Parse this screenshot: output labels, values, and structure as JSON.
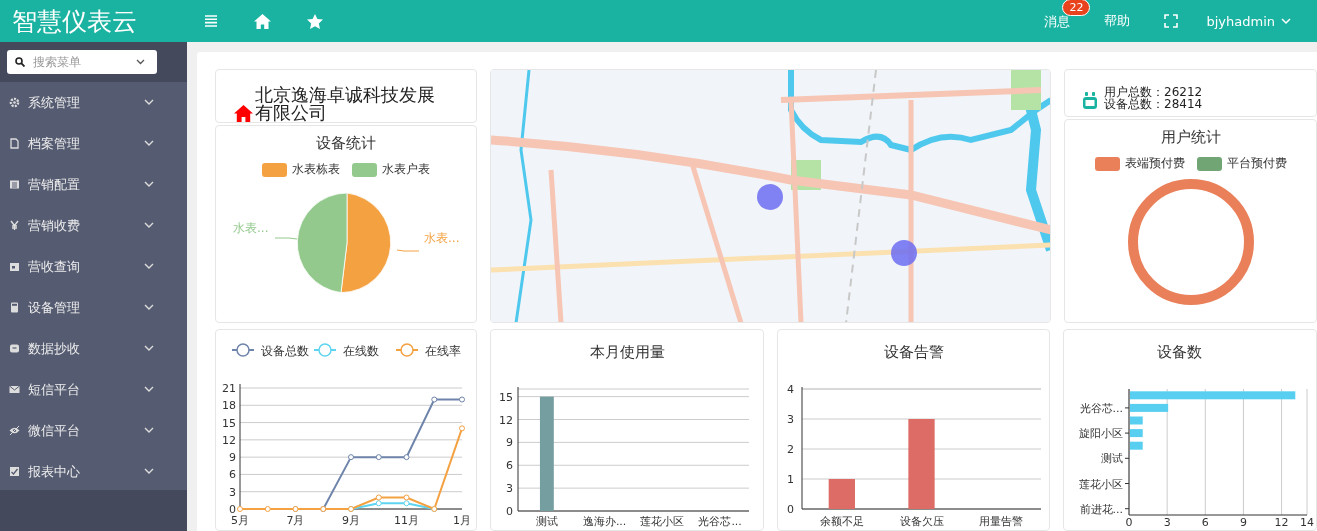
{
  "header": {
    "title": "智慧仪表云",
    "messages": {
      "label": "消息",
      "count": "22"
    },
    "help": "帮助",
    "user": "bjyhadmin"
  },
  "sidebar": {
    "search": {
      "placeholder": "搜索菜单"
    },
    "items": [
      {
        "label": "系统管理",
        "expanded": false
      },
      {
        "label": "档案管理",
        "expanded": false
      },
      {
        "label": "营销配置",
        "expanded": false
      },
      {
        "label": "营销收费",
        "expanded": false
      },
      {
        "label": "营收查询",
        "expanded": false
      },
      {
        "label": "设备管理",
        "expanded": false
      },
      {
        "label": "数据抄收",
        "expanded": false
      },
      {
        "label": "短信平台",
        "expanded": false
      },
      {
        "label": "微信平台",
        "expanded": false
      },
      {
        "label": "报表中心",
        "expanded": false
      }
    ]
  },
  "company": {
    "name": "北京逸海卓诚科技发展有限公司"
  },
  "device_stats": {
    "title": "设备统计",
    "legend": [
      {
        "label": "水表栋表",
        "color": "#f4a142",
        "slice_label": "水表..."
      },
      {
        "label": "水表户表",
        "color": "#93c98c",
        "slice_label": "水表..."
      }
    ]
  },
  "totals": [
    "用户总数：26212",
    "设备总数：28414"
  ],
  "user_stats": {
    "title": "用户统计",
    "legend": [
      {
        "label": "表端预付费",
        "color": "#e9805a"
      },
      {
        "label": "平台预付费",
        "color": "#72a574"
      }
    ]
  },
  "device_trend": {
    "chart_data": {
      "type": "line",
      "x": [
        "5月",
        null,
        "7月",
        null,
        "9月",
        null,
        "11月",
        null,
        "1月"
      ],
      "legend": "top",
      "grid": true,
      "ylim": [
        0,
        21
      ],
      "yticks": [
        0,
        3,
        6,
        9,
        12,
        15,
        18,
        21
      ],
      "series": [
        {
          "name": "设备总数",
          "color": "#6f84ab",
          "marker": "circle",
          "values": [
            null,
            null,
            0,
            0,
            9,
            9,
            9,
            19,
            19
          ]
        },
        {
          "name": "在线数",
          "color": "#5dd4f0",
          "marker": "circle",
          "values": [
            null,
            null,
            null,
            null,
            0,
            1,
            1,
            0,
            null
          ]
        },
        {
          "name": "在线率",
          "color": "#f4a142",
          "marker": "circle",
          "values": [
            0,
            0,
            0,
            0,
            0,
            2,
            2,
            0,
            14
          ]
        }
      ]
    }
  },
  "monthly_usage": {
    "chart_data": {
      "type": "bar",
      "title": "本月使用量",
      "grid": true,
      "categories": [
        "测试",
        "逸海办...",
        "莲花小区",
        "光谷芯..."
      ],
      "ylim": [
        0,
        16
      ],
      "yticks": [
        0,
        3,
        6,
        9,
        12,
        15
      ],
      "series": [
        {
          "color": "#749e9f",
          "values": [
            15,
            0,
            0,
            0
          ]
        }
      ]
    }
  },
  "device_alarms": {
    "chart_data": {
      "type": "bar",
      "title": "设备告警",
      "grid": true,
      "categories": [
        "余额不足",
        "设备欠压",
        "用量告警"
      ],
      "ylim": [
        0,
        4
      ],
      "yticks": [
        0,
        1,
        2,
        3,
        4
      ],
      "series": [
        {
          "color": "#dd6b66",
          "values": [
            1,
            3,
            0
          ]
        }
      ]
    }
  },
  "device_count": {
    "chart_data": {
      "type": "bar",
      "orientation": "horizontal",
      "title": "设备数",
      "grid": true,
      "categories": [
        null,
        "光谷芯...",
        null,
        "旋阳小区",
        null,
        "测试",
        null,
        "莲花小区",
        null,
        "前进花..."
      ],
      "xlim": [
        0,
        14
      ],
      "xticks": [
        0,
        3,
        6,
        9,
        12,
        14
      ],
      "series": [
        {
          "color": "#58cff0",
          "values": [
            13,
            3,
            1,
            1,
            1,
            0,
            0,
            0,
            0,
            0
          ]
        }
      ]
    }
  }
}
